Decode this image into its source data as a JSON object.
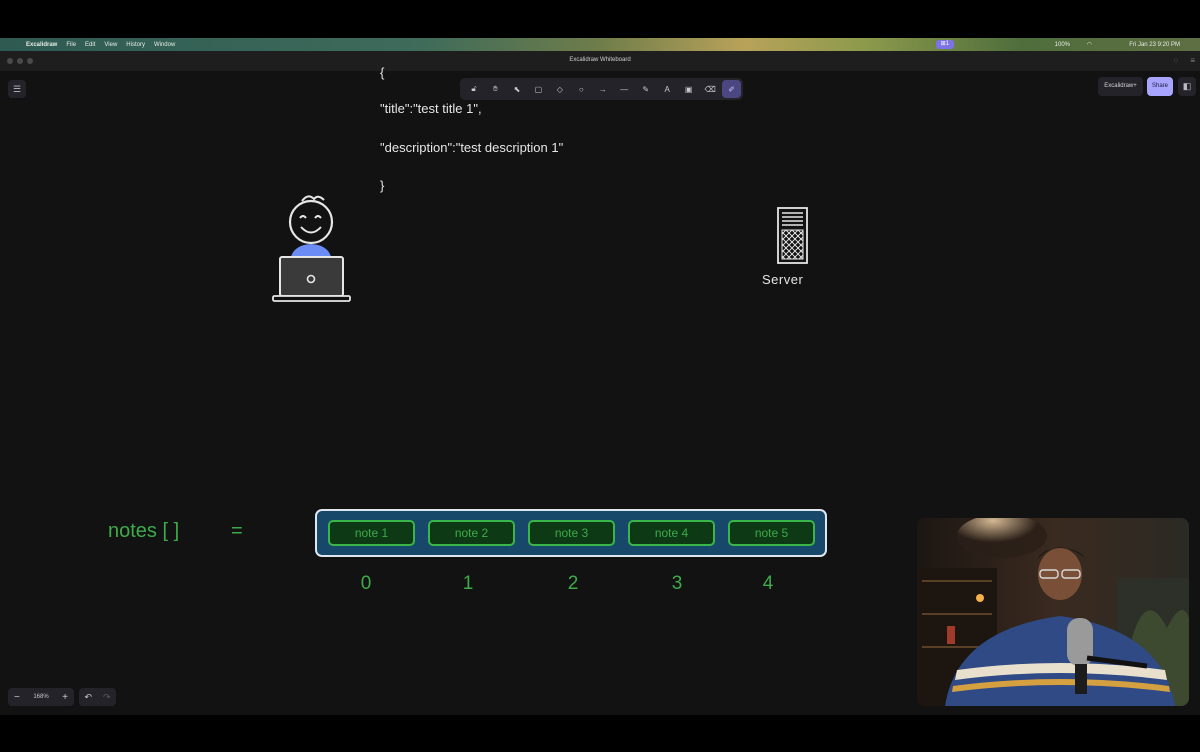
{
  "menubar": {
    "apple_icon": "apple-logo-icon",
    "app_name": "Excalidraw",
    "menus": [
      "File",
      "Edit",
      "View",
      "History",
      "Window"
    ],
    "status_pill": "⊞1",
    "battery": "100%",
    "datetime": "Fri Jan 23  9:20 PM"
  },
  "window": {
    "title": "Excalidraw Whiteboard"
  },
  "toolbar": {
    "tools": [
      {
        "icon": "lock-icon",
        "glyph": "🔓︎"
      },
      {
        "icon": "hand-icon",
        "glyph": "✋︎"
      },
      {
        "icon": "selection-icon",
        "glyph": "⬉"
      },
      {
        "icon": "rectangle-icon",
        "glyph": "▢"
      },
      {
        "icon": "diamond-icon",
        "glyph": "◇"
      },
      {
        "icon": "ellipse-icon",
        "glyph": "○"
      },
      {
        "icon": "arrow-icon",
        "glyph": "→"
      },
      {
        "icon": "line-icon",
        "glyph": "—"
      },
      {
        "icon": "pencil-icon",
        "glyph": "✎"
      },
      {
        "icon": "text-icon",
        "glyph": "A"
      },
      {
        "icon": "image-icon",
        "glyph": "▣"
      },
      {
        "icon": "eraser-icon",
        "glyph": "⌫"
      },
      {
        "icon": "laser-icon",
        "glyph": "✐"
      }
    ],
    "active_index": 12
  },
  "header": {
    "library_label": "Excalidraw+",
    "share_label": "Share"
  },
  "canvas": {
    "json_lines": [
      "{",
      "\"title\":\"test title 1\",",
      "\"description\":\"test description 1\"",
      "}"
    ],
    "server_label": "Server",
    "notes_label": "notes [ ]",
    "equals": "=",
    "notes": [
      "note 1",
      "note 2",
      "note 3",
      "note 4",
      "note 5"
    ],
    "indices": [
      "0",
      "1",
      "2",
      "3",
      "4"
    ]
  },
  "footer": {
    "zoom_out": "−",
    "zoom_level": "168%",
    "zoom_in": "+",
    "undo": "↶",
    "redo": "↷"
  },
  "colors": {
    "accent": "#a8a5ff",
    "notes_green": "#3dab4a",
    "array_fill": "#174769"
  }
}
